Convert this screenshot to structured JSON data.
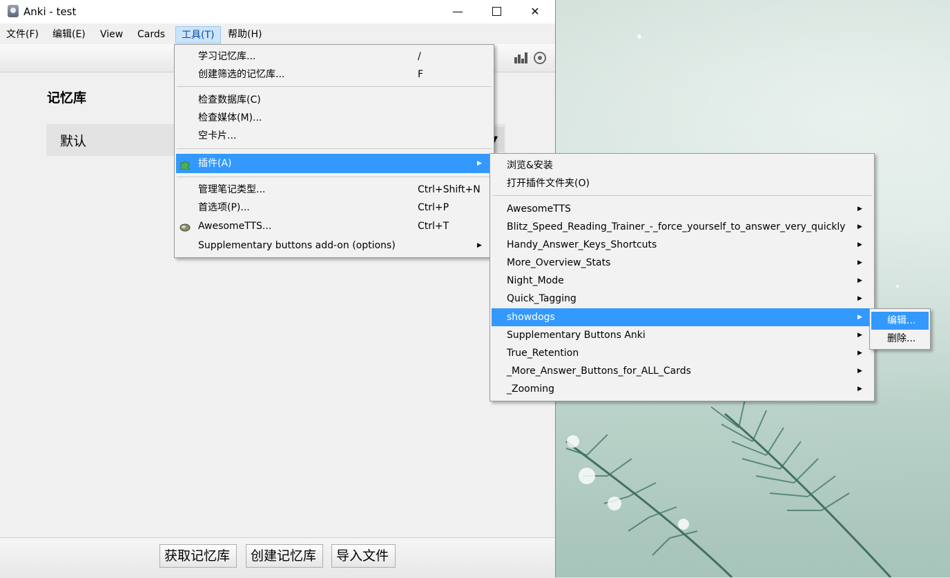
{
  "window": {
    "title": "Anki - test",
    "controls": {
      "minimize": "—",
      "maximize": "",
      "close": "✕"
    }
  },
  "menubar": {
    "items": [
      "文件(F)",
      "编辑(E)",
      "View",
      "Cards",
      "工具(T)",
      "帮助(H)"
    ],
    "active": "工具(T)"
  },
  "main": {
    "heading": "记忆库",
    "decks": [
      {
        "name": "默认"
      }
    ],
    "gear_glyph": "▼"
  },
  "bottom_buttons": [
    "获取记忆库",
    "创建记忆库",
    "导入文件"
  ],
  "tools_menu": {
    "items": [
      {
        "label": "学习记忆库...",
        "shortcut": "/"
      },
      {
        "label": "创建筛选的记忆库...",
        "shortcut": "F"
      },
      {
        "label": "检查数据库(C)"
      },
      {
        "label": "检查媒体(M)..."
      },
      {
        "label": "空卡片..."
      },
      {
        "label": "插件(A)",
        "icon": "puzzle-piece-icon",
        "submenu": true,
        "highlighted": true
      },
      {
        "label": "管理笔记类型...",
        "shortcut": "Ctrl+Shift+N"
      },
      {
        "label": "首选项(P)...",
        "shortcut": "Ctrl+P"
      },
      {
        "label": "AwesomeTTS...",
        "shortcut": "Ctrl+T",
        "icon": "speaker-icon"
      },
      {
        "label": "Supplementary buttons add-on (options)",
        "submenu": true
      }
    ]
  },
  "addons_menu": {
    "items": [
      {
        "label": "浏览&安装"
      },
      {
        "label": "打开插件文件夹(O)"
      },
      {
        "label": "AwesomeTTS",
        "submenu": true
      },
      {
        "label": "Blitz_Speed_Reading_Trainer_-_force_yourself_to_answer_very_quickly",
        "submenu": true
      },
      {
        "label": "Handy_Answer_Keys_Shortcuts",
        "submenu": true
      },
      {
        "label": "More_Overview_Stats",
        "submenu": true
      },
      {
        "label": "Night_Mode",
        "submenu": true
      },
      {
        "label": "Quick_Tagging",
        "submenu": true
      },
      {
        "label": "showdogs",
        "submenu": true,
        "highlighted": true
      },
      {
        "label": "Supplementary Buttons Anki",
        "submenu": true
      },
      {
        "label": "True_Retention",
        "submenu": true
      },
      {
        "label": "_More_Answer_Buttons_for_ALL_Cards",
        "submenu": true
      },
      {
        "label": "_Zooming",
        "submenu": true
      }
    ]
  },
  "showdogs_menu": {
    "items": [
      {
        "label": "编辑...",
        "highlighted": true
      },
      {
        "label": "删除..."
      }
    ]
  },
  "submenu_arrow": "▶",
  "colors": {
    "highlight": "#3399ff",
    "menu_bg": "#f2f2f2",
    "window_bg": "#f0f0f0"
  }
}
